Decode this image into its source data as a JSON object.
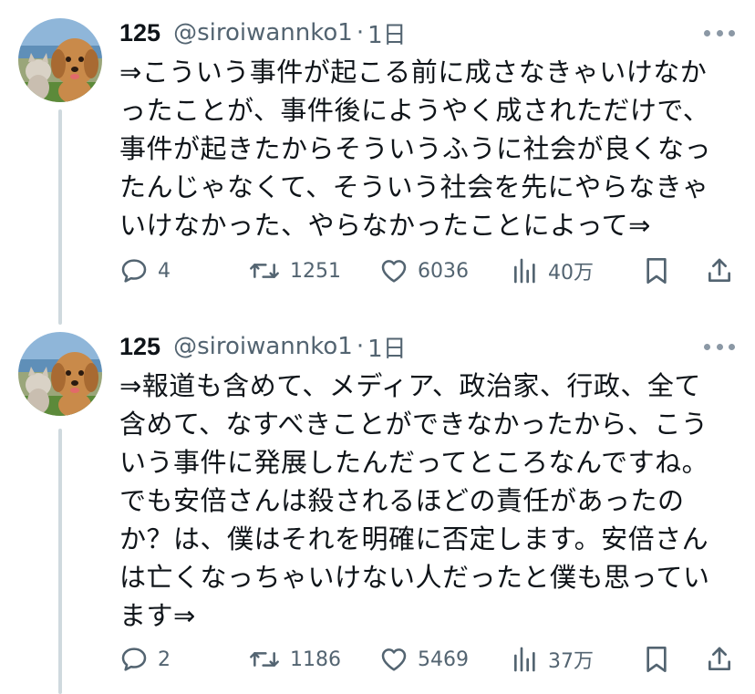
{
  "tweets": [
    {
      "display_name": "125",
      "handle": "@siroiwannko1",
      "separator": "·",
      "time": "1日",
      "text": "⇒こういう事件が起こる前に成さなきゃいけなか\nったことが、事件後にようやく成されただけで、\n事件が起きたからそういうふうに社会が良くなっ\nたんじゃなくて、そういう社会を先にやらなきゃ\nいけなかった、やらなかったことによって⇒",
      "replies": "4",
      "reposts": "1251",
      "likes": "6036",
      "views": "40万"
    },
    {
      "display_name": "125",
      "handle": "@siroiwannko1",
      "separator": "·",
      "time": "1日",
      "text": "⇒報道も含めて、メディア、政治家、行政、全て\n含めて、なすべきことができなかったから、こう\nいう事件に発展したんだってところなんですね。\nでも安倍さんは殺されるほどの責任があったの\nか？は、僕はそれを明確に否定します。安倍さん\nは亡くなっちゃいけない人だったと僕も思ってい\nます⇒",
      "replies": "2",
      "reposts": "1186",
      "likes": "5469",
      "views": "37万"
    }
  ],
  "icons": {
    "avatar": "dog-and-cat-photo-avatar",
    "more": "more-options-icon",
    "reply": "reply-icon",
    "repost": "repost-icon",
    "like": "heart-icon",
    "views": "views-icon",
    "bookmark": "bookmark-icon",
    "share": "share-icon"
  },
  "colors": {
    "text": "#0f1419",
    "secondary": "#536471",
    "thread_line": "#cfd9de",
    "background": "#ffffff"
  }
}
